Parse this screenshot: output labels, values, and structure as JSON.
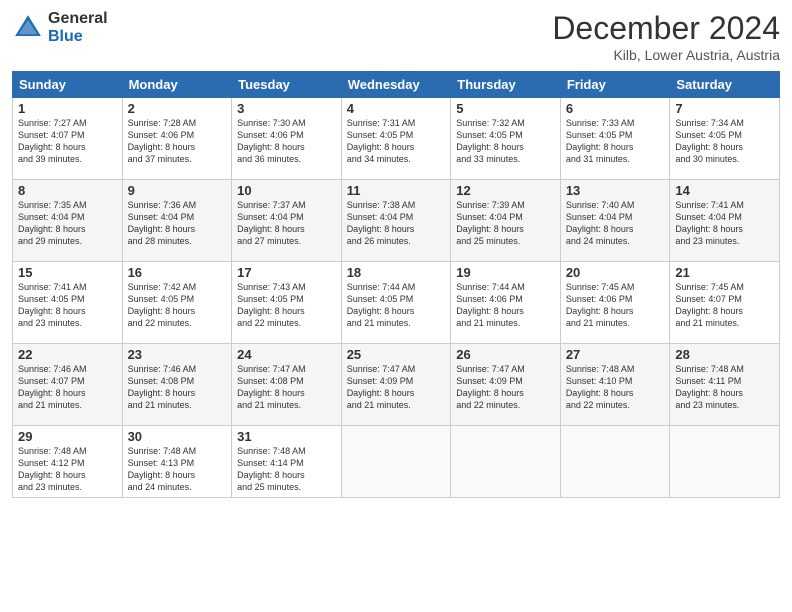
{
  "header": {
    "logo_general": "General",
    "logo_blue": "Blue",
    "title": "December 2024",
    "location": "Kilb, Lower Austria, Austria"
  },
  "days_of_week": [
    "Sunday",
    "Monday",
    "Tuesday",
    "Wednesday",
    "Thursday",
    "Friday",
    "Saturday"
  ],
  "weeks": [
    [
      {
        "day": "1",
        "lines": [
          "Sunrise: 7:27 AM",
          "Sunset: 4:07 PM",
          "Daylight: 8 hours",
          "and 39 minutes."
        ]
      },
      {
        "day": "2",
        "lines": [
          "Sunrise: 7:28 AM",
          "Sunset: 4:06 PM",
          "Daylight: 8 hours",
          "and 37 minutes."
        ]
      },
      {
        "day": "3",
        "lines": [
          "Sunrise: 7:30 AM",
          "Sunset: 4:06 PM",
          "Daylight: 8 hours",
          "and 36 minutes."
        ]
      },
      {
        "day": "4",
        "lines": [
          "Sunrise: 7:31 AM",
          "Sunset: 4:05 PM",
          "Daylight: 8 hours",
          "and 34 minutes."
        ]
      },
      {
        "day": "5",
        "lines": [
          "Sunrise: 7:32 AM",
          "Sunset: 4:05 PM",
          "Daylight: 8 hours",
          "and 33 minutes."
        ]
      },
      {
        "day": "6",
        "lines": [
          "Sunrise: 7:33 AM",
          "Sunset: 4:05 PM",
          "Daylight: 8 hours",
          "and 31 minutes."
        ]
      },
      {
        "day": "7",
        "lines": [
          "Sunrise: 7:34 AM",
          "Sunset: 4:05 PM",
          "Daylight: 8 hours",
          "and 30 minutes."
        ]
      }
    ],
    [
      {
        "day": "8",
        "lines": [
          "Sunrise: 7:35 AM",
          "Sunset: 4:04 PM",
          "Daylight: 8 hours",
          "and 29 minutes."
        ]
      },
      {
        "day": "9",
        "lines": [
          "Sunrise: 7:36 AM",
          "Sunset: 4:04 PM",
          "Daylight: 8 hours",
          "and 28 minutes."
        ]
      },
      {
        "day": "10",
        "lines": [
          "Sunrise: 7:37 AM",
          "Sunset: 4:04 PM",
          "Daylight: 8 hours",
          "and 27 minutes."
        ]
      },
      {
        "day": "11",
        "lines": [
          "Sunrise: 7:38 AM",
          "Sunset: 4:04 PM",
          "Daylight: 8 hours",
          "and 26 minutes."
        ]
      },
      {
        "day": "12",
        "lines": [
          "Sunrise: 7:39 AM",
          "Sunset: 4:04 PM",
          "Daylight: 8 hours",
          "and 25 minutes."
        ]
      },
      {
        "day": "13",
        "lines": [
          "Sunrise: 7:40 AM",
          "Sunset: 4:04 PM",
          "Daylight: 8 hours",
          "and 24 minutes."
        ]
      },
      {
        "day": "14",
        "lines": [
          "Sunrise: 7:41 AM",
          "Sunset: 4:04 PM",
          "Daylight: 8 hours",
          "and 23 minutes."
        ]
      }
    ],
    [
      {
        "day": "15",
        "lines": [
          "Sunrise: 7:41 AM",
          "Sunset: 4:05 PM",
          "Daylight: 8 hours",
          "and 23 minutes."
        ]
      },
      {
        "day": "16",
        "lines": [
          "Sunrise: 7:42 AM",
          "Sunset: 4:05 PM",
          "Daylight: 8 hours",
          "and 22 minutes."
        ]
      },
      {
        "day": "17",
        "lines": [
          "Sunrise: 7:43 AM",
          "Sunset: 4:05 PM",
          "Daylight: 8 hours",
          "and 22 minutes."
        ]
      },
      {
        "day": "18",
        "lines": [
          "Sunrise: 7:44 AM",
          "Sunset: 4:05 PM",
          "Daylight: 8 hours",
          "and 21 minutes."
        ]
      },
      {
        "day": "19",
        "lines": [
          "Sunrise: 7:44 AM",
          "Sunset: 4:06 PM",
          "Daylight: 8 hours",
          "and 21 minutes."
        ]
      },
      {
        "day": "20",
        "lines": [
          "Sunrise: 7:45 AM",
          "Sunset: 4:06 PM",
          "Daylight: 8 hours",
          "and 21 minutes."
        ]
      },
      {
        "day": "21",
        "lines": [
          "Sunrise: 7:45 AM",
          "Sunset: 4:07 PM",
          "Daylight: 8 hours",
          "and 21 minutes."
        ]
      }
    ],
    [
      {
        "day": "22",
        "lines": [
          "Sunrise: 7:46 AM",
          "Sunset: 4:07 PM",
          "Daylight: 8 hours",
          "and 21 minutes."
        ]
      },
      {
        "day": "23",
        "lines": [
          "Sunrise: 7:46 AM",
          "Sunset: 4:08 PM",
          "Daylight: 8 hours",
          "and 21 minutes."
        ]
      },
      {
        "day": "24",
        "lines": [
          "Sunrise: 7:47 AM",
          "Sunset: 4:08 PM",
          "Daylight: 8 hours",
          "and 21 minutes."
        ]
      },
      {
        "day": "25",
        "lines": [
          "Sunrise: 7:47 AM",
          "Sunset: 4:09 PM",
          "Daylight: 8 hours",
          "and 21 minutes."
        ]
      },
      {
        "day": "26",
        "lines": [
          "Sunrise: 7:47 AM",
          "Sunset: 4:09 PM",
          "Daylight: 8 hours",
          "and 22 minutes."
        ]
      },
      {
        "day": "27",
        "lines": [
          "Sunrise: 7:48 AM",
          "Sunset: 4:10 PM",
          "Daylight: 8 hours",
          "and 22 minutes."
        ]
      },
      {
        "day": "28",
        "lines": [
          "Sunrise: 7:48 AM",
          "Sunset: 4:11 PM",
          "Daylight: 8 hours",
          "and 23 minutes."
        ]
      }
    ],
    [
      {
        "day": "29",
        "lines": [
          "Sunrise: 7:48 AM",
          "Sunset: 4:12 PM",
          "Daylight: 8 hours",
          "and 23 minutes."
        ]
      },
      {
        "day": "30",
        "lines": [
          "Sunrise: 7:48 AM",
          "Sunset: 4:13 PM",
          "Daylight: 8 hours",
          "and 24 minutes."
        ]
      },
      {
        "day": "31",
        "lines": [
          "Sunrise: 7:48 AM",
          "Sunset: 4:14 PM",
          "Daylight: 8 hours",
          "and 25 minutes."
        ]
      },
      {
        "day": "",
        "lines": []
      },
      {
        "day": "",
        "lines": []
      },
      {
        "day": "",
        "lines": []
      },
      {
        "day": "",
        "lines": []
      }
    ]
  ]
}
